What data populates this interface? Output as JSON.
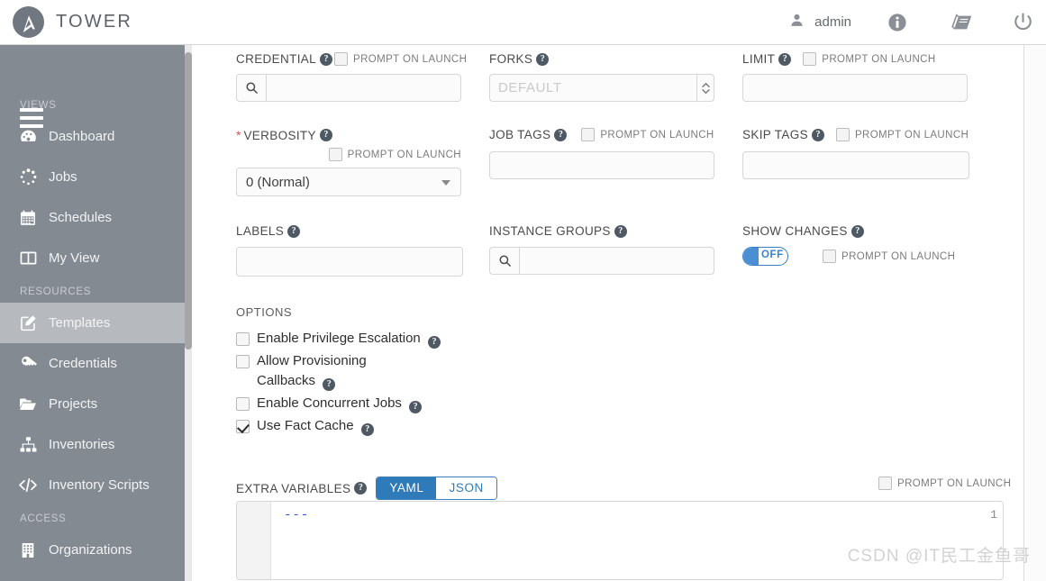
{
  "header": {
    "brand": "TOWER",
    "brand_logo_icon": "ansible-tower-logo-icon",
    "user": "admin",
    "user_icon": "user-icon",
    "info_icon": "info-circle-icon",
    "docs_icon": "book-icon",
    "power_icon": "power-off-icon"
  },
  "sidebar": {
    "menu_icon": "hamburger-menu-icon",
    "sections": [
      {
        "title": "VIEWS",
        "items": [
          {
            "label": "Dashboard",
            "icon": "dashboard-gauge-icon",
            "active": false
          },
          {
            "label": "Jobs",
            "icon": "jobs-spinner-icon",
            "active": false
          },
          {
            "label": "Schedules",
            "icon": "calendar-icon",
            "active": false
          },
          {
            "label": "My View",
            "icon": "columns-icon",
            "active": false
          }
        ]
      },
      {
        "title": "RESOURCES",
        "items": [
          {
            "label": "Templates",
            "icon": "pencil-square-icon",
            "active": true
          },
          {
            "label": "Credentials",
            "icon": "key-icon",
            "active": false
          },
          {
            "label": "Projects",
            "icon": "folder-icon",
            "active": false
          },
          {
            "label": "Inventories",
            "icon": "sitemap-icon",
            "active": false
          },
          {
            "label": "Inventory Scripts",
            "icon": "code-icon",
            "active": false
          }
        ]
      },
      {
        "title": "ACCESS",
        "items": [
          {
            "label": "Organizations",
            "icon": "building-icon",
            "active": false
          }
        ]
      }
    ]
  },
  "form": {
    "prompt_on_launch_label": "PROMPT ON LAUNCH",
    "help_icon": "help-circle-icon",
    "search_icon": "search-icon",
    "credential": {
      "label": "CREDENTIAL",
      "value": "",
      "placeholder": "",
      "prompt_on_launch": false
    },
    "forks": {
      "label": "FORKS",
      "value": "",
      "placeholder": "DEFAULT",
      "stepper_icon": "stepper-up-down-icon"
    },
    "limit": {
      "label": "LIMIT",
      "value": "",
      "placeholder": "",
      "prompt_on_launch": false
    },
    "verbosity": {
      "label": "VERBOSITY",
      "required": true,
      "selected": "0 (Normal)",
      "prompt_on_launch": false,
      "dropdown_icon": "chevron-down-icon"
    },
    "job_tags": {
      "label": "JOB TAGS",
      "value": "",
      "prompt_on_launch": false
    },
    "skip_tags": {
      "label": "SKIP TAGS",
      "value": "",
      "prompt_on_launch": false
    },
    "labels": {
      "label": "LABELS",
      "value": ""
    },
    "instance_groups": {
      "label": "INSTANCE GROUPS",
      "value": ""
    },
    "show_changes": {
      "label": "SHOW CHANGES",
      "toggle_state": "OFF",
      "prompt_on_launch": false
    },
    "options": {
      "title": "OPTIONS",
      "items": [
        {
          "label": "Enable Privilege Escalation",
          "checked": false
        },
        {
          "label": "Allow Provisioning Callbacks",
          "checked": false
        },
        {
          "label": "Enable Concurrent Jobs",
          "checked": false
        },
        {
          "label": "Use Fact Cache",
          "checked": true
        }
      ]
    },
    "extra_variables": {
      "label": "EXTRA VARIABLES",
      "formats": [
        {
          "label": "YAML",
          "active": true
        },
        {
          "label": "JSON",
          "active": false
        }
      ],
      "prompt_on_launch": false,
      "editor": {
        "line_number": "1",
        "code": "---"
      }
    }
  },
  "watermark": "CSDN @IT民工金鱼哥",
  "colors": {
    "sidebar_bg": "#848a92",
    "sidebar_active": "#b6b9bd",
    "accent_blue": "#2f7ab8",
    "toggle_blue": "#4a8fd2",
    "required_red": "#d9534f"
  }
}
